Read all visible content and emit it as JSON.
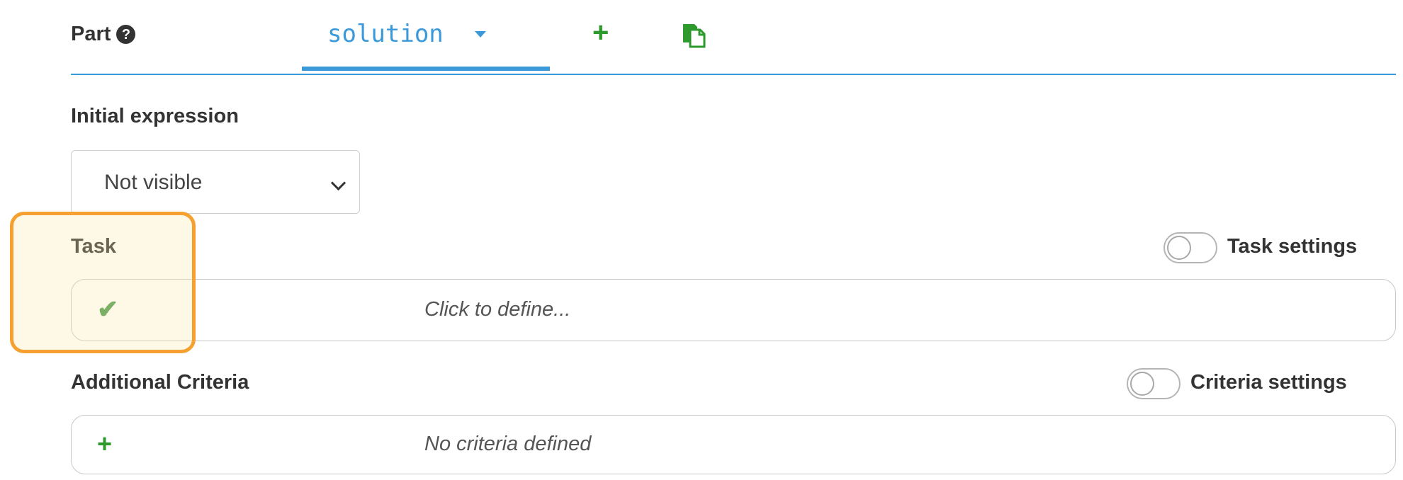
{
  "part": {
    "label": "Part",
    "help_icon": "question-circle-icon",
    "help_glyph": "?",
    "active_tab": "solution",
    "add_glyph": "+",
    "accent_color": "#3b99d9"
  },
  "initial_expression": {
    "label": "Initial expression",
    "selected_value": "Not visible"
  },
  "task": {
    "label": "Task",
    "settings_label": "Task settings",
    "settings_enabled": false,
    "field_icon": "checkmark-icon",
    "field_glyph": "✔",
    "placeholder": "Click to define..."
  },
  "criteria": {
    "label": "Additional Criteria",
    "settings_label": "Criteria settings",
    "settings_enabled": false,
    "field_icon": "plus-icon",
    "field_glyph": "+",
    "placeholder": "No criteria defined"
  },
  "colors": {
    "highlight_border": "#f5a030",
    "add_green": "#2e9a2e",
    "check_green": "#4c9a4c"
  }
}
